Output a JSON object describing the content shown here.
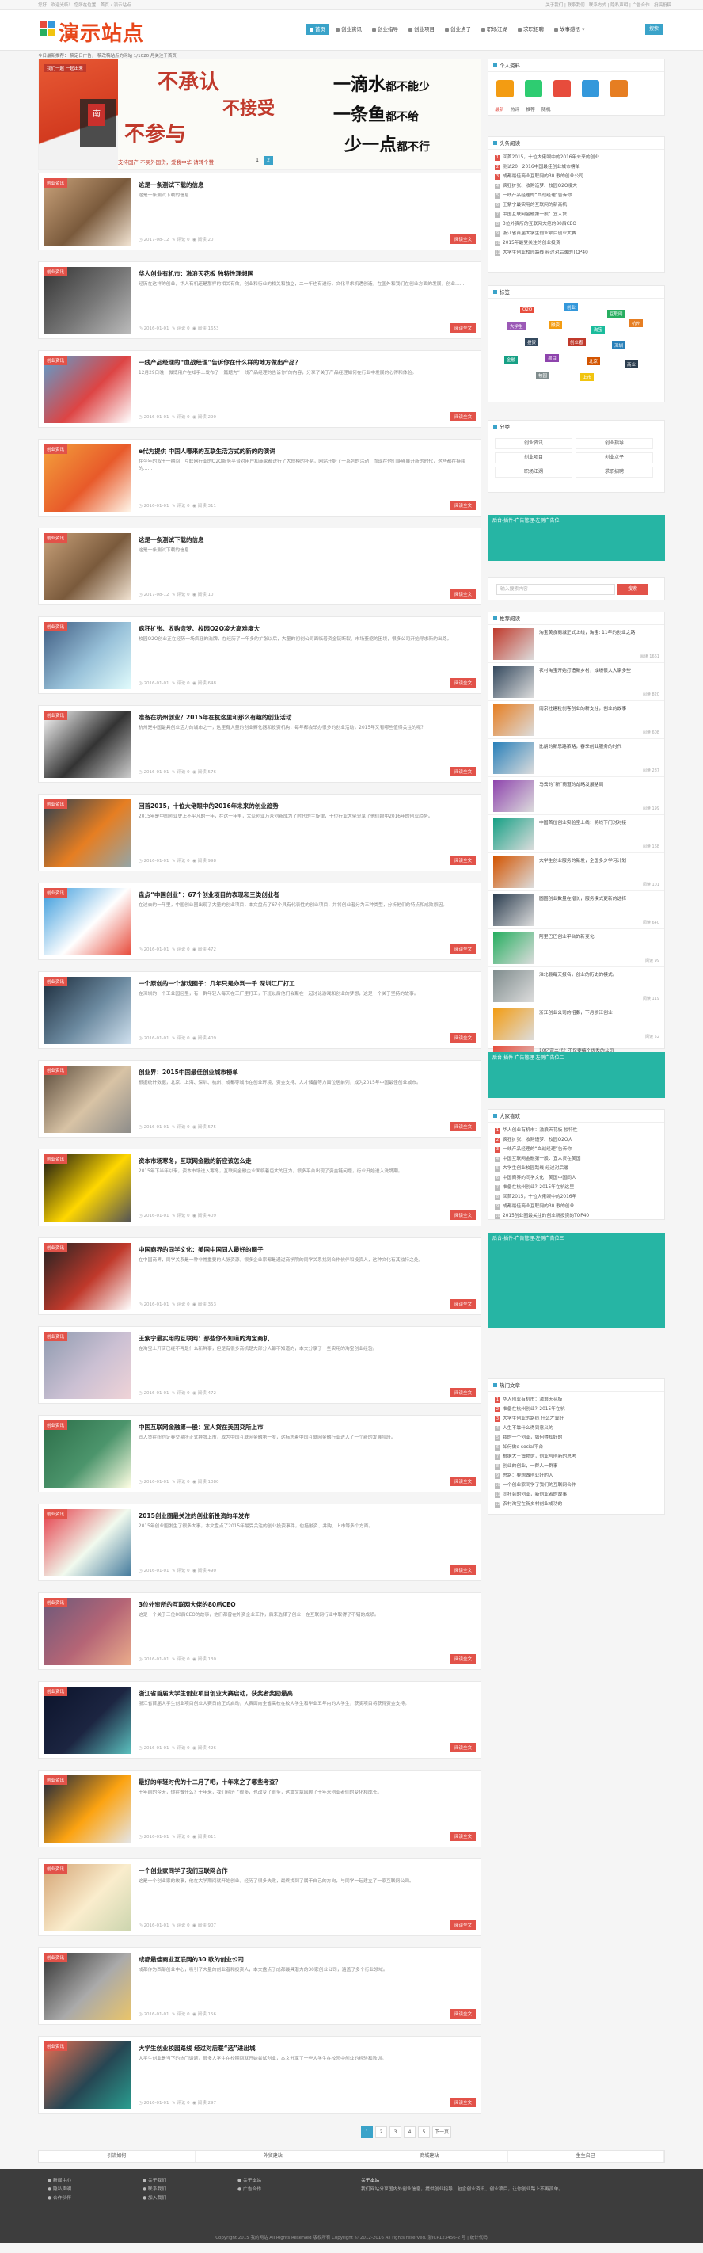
{
  "topbar": {
    "left": "您好：欢迎光临！ 您所在位置：首页 › 演示站点",
    "right": "关于我们 | 联系我们 | 联系方式 | 隐私声明 | 广告合作 | 投稿投稿"
  },
  "logo": {
    "text": "演示站点"
  },
  "nav": {
    "items": [
      {
        "label": "首页",
        "active": true
      },
      {
        "label": "创业资讯",
        "active": false
      },
      {
        "label": "创业指导",
        "active": false
      },
      {
        "label": "创业项目",
        "active": false
      },
      {
        "label": "创业点子",
        "active": false
      },
      {
        "label": "职场江湖",
        "active": false
      },
      {
        "label": "求职招聘",
        "active": false
      },
      {
        "label": "故事感悟 ▾",
        "active": false
      }
    ],
    "search_label": "搜索"
  },
  "breadcrumb": "今日最新推荐：  稿定日广告， 稿改稿站点的网站 1/1020 月关注于首页",
  "banner": {
    "tag": "我们一起 一起出来",
    "seal": "南",
    "line1": "不承认",
    "line2": "不接受",
    "line3": "不参与",
    "k1a": "一滴水",
    "k1b": "都不能少",
    "k2a": "一条鱼",
    "k2b": "都不给",
    "k3a": "少一点",
    "k3b": "都不行",
    "bottom": "支持国产 不买外国货，爱我中华 请转个赞",
    "pages": [
      "1",
      "2"
    ]
  },
  "articles": [
    {
      "cat": "创业资讯",
      "title": "这是一条测试下载的信息",
      "excerpt": "这是一条测试下载的信息",
      "date": "2017-08-12",
      "views": "评论 0",
      "read": "阅读 20",
      "more": "阅读全文"
    },
    {
      "cat": "创业资讯",
      "title": "华人创业有机市：激浪天花板 独特性理想国",
      "excerpt": "经历在这样的创业，华人有机还是那样的相关有效，创业和行业的相关和独立，二十年也有进行，文化寻求机遇创造，在国外和我们在创业方面的发展，创业……",
      "date": "2016-01-01",
      "views": "评论 0",
      "read": "阅读 1653",
      "more": "阅读全文"
    },
    {
      "cat": "创业资讯",
      "title": "一线产品经理的“血战经理”告诉你在什么样的地方做出产品？",
      "excerpt": "12月29日晚，微博用户在知乎上发布了一篇题为“一线产品经理的告诉你”的内容，分享了关于产品经理如何在行业中发展的心得和体验。",
      "date": "2016-01-01",
      "views": "评论 0",
      "read": "阅读 290",
      "more": "阅读全文"
    },
    {
      "cat": "创业资讯",
      "title": "e代为提供 中国人哪来的互联生活方式的新的的演讲",
      "excerpt": "在今年的双十一期间，互联网行业的O2O服务平台对用户和商家都进行了大规模的补贴，网站开始了一系列的活动，而现在他们能够展开新的时代，这些都在持续的……",
      "date": "2016-01-01",
      "views": "评论 0",
      "read": "阅读 311",
      "more": "阅读全文"
    },
    {
      "cat": "创业资讯",
      "title": "这是一条测试下载的信息",
      "excerpt": "这是一条测试下载的信息",
      "date": "2017-08-12",
      "views": "评论 0",
      "read": "阅读 10",
      "more": "阅读全文"
    },
    {
      "cat": "创业资讯",
      "title": "疯狂扩张、收购造梦、校园O2O凌大高难度大",
      "excerpt": "校园O2O创业正在经历一场疯狂的洗牌，在经历了一年多的扩张以后，大量的初创公司面临着资金链断裂、市场萎缩的困境，很多公司开始寻求新的出路。",
      "date": "2016-01-01",
      "views": "评论 0",
      "read": "阅读 648",
      "more": "阅读全文"
    },
    {
      "cat": "创业资讯",
      "title": "准备在杭州创业？2015年在杭这里和那么有趣的创业活动",
      "excerpt": "杭州是中国最具创业活力的城市之一，这里有大量的创业孵化器和投资机构，每年都会举办很多的创业活动，2015年又有哪些值得关注的呢？",
      "date": "2016-01-01",
      "views": "评论 0",
      "read": "阅读 576",
      "more": "阅读全文"
    },
    {
      "cat": "创业资讯",
      "title": "回首2015，十位大佬眼中的2016年未来的创业趋势",
      "excerpt": "2015年是中国创业史上不平凡的一年，在这一年里，大众创业万众创新成为了时代的主旋律，十位行业大佬分享了他们眼中2016年的创业趋势。",
      "date": "2016-01-01",
      "views": "评论 0",
      "read": "阅读 998",
      "more": "阅读全文"
    },
    {
      "cat": "创业资讯",
      "title": "盘点“中国创业”：67个创业项目的表现和三类创业者",
      "excerpt": "在过去的一年里，中国创业圈出现了大量的创业项目，本文盘点了67个具有代表性的创业项目，并将创业者分为三种类型，分析他们的特点和成败原因。",
      "date": "2016-01-01",
      "views": "评论 0",
      "read": "阅读 472",
      "more": "阅读全文"
    },
    {
      "cat": "创业资讯",
      "title": "一个原创的一个游戏圈子：几年只是办到一千 深圳江厂打工",
      "excerpt": "在深圳的一个工业园区里，有一群年轻人每天在工厂里打工，下班以后他们会聚在一起讨论游戏和创业的梦想，这是一个关于坚持的故事。",
      "date": "2016-01-01",
      "views": "评论 0",
      "read": "阅读 409",
      "more": "阅读全文"
    },
    {
      "cat": "创业资讯",
      "title": "创业界：2015中国最佳创业城市榜单",
      "excerpt": "根据统计数据，北京、上海、深圳、杭州、成都等城市在创业环境、资金支持、人才储备等方面位居前列，成为2015年中国最佳创业城市。",
      "date": "2016-01-01",
      "views": "评论 0",
      "read": "阅读 575",
      "more": "阅读全文"
    },
    {
      "cat": "创业资讯",
      "title": "资本市场寒冬，互联网金融的新应该怎么走",
      "excerpt": "2015年下半年以来，资本市场进入寒冬，互联网金融企业面临着巨大的压力，很多平台出现了资金链问题，行业开始进入洗牌期。",
      "date": "2016-01-01",
      "views": "评论 0",
      "read": "阅读 409",
      "more": "阅读全文"
    },
    {
      "cat": "创业资讯",
      "title": "中国商界的同学文化：美国中国同人最好的圈子",
      "excerpt": "在中国商界，同学关系是一种非常重要的人脉资源，很多企业家都是通过商学院的同学关系找到合作伙伴和投资人，这种文化有其独特之处。",
      "date": "2016-01-01",
      "views": "评论 0",
      "read": "阅读 353",
      "more": "阅读全文"
    },
    {
      "cat": "创业资讯",
      "title": "王紫宁最实用的互联网：那些你不知道的淘宝商机",
      "excerpt": "在淘宝上开店已经不再是什么新鲜事，但是有很多商机是大部分人都不知道的，本文分享了一些实用的淘宝创业经验。",
      "date": "2016-01-01",
      "views": "评论 0",
      "read": "阅读 472",
      "more": "阅读全文"
    },
    {
      "cat": "创业资讯",
      "title": "中国互联网金融第一股：宜人贷在美国交所上市",
      "excerpt": "宜人贷在纽约证券交易所正式挂牌上市，成为中国互联网金融第一股，这标志着中国互联网金融行业进入了一个新的发展阶段。",
      "date": "2016-01-01",
      "views": "评论 0",
      "read": "阅读 1080",
      "more": "阅读全文"
    },
    {
      "cat": "创业资讯",
      "title": "2015创业圈最关注的创业新投资的年发布",
      "excerpt": "2015年创业圈发生了很多大事，本文盘点了2015年最受关注的创业投资事件，包括融资、并购、上市等多个方面。",
      "date": "2016-01-01",
      "views": "评论 0",
      "read": "阅读 490",
      "more": "阅读全文"
    },
    {
      "cat": "创业资讯",
      "title": "3位外资所的互联网大佬的80后CEO",
      "excerpt": "这是一个关于三位80后CEO的故事，他们都曾在外资企业工作，后来选择了创业，在互联网行业中取得了不错的成绩。",
      "date": "2016-01-01",
      "views": "评论 0",
      "read": "阅读 130",
      "more": "阅读全文"
    },
    {
      "cat": "创业资讯",
      "title": "浙江省首届大学生创业项目创业大赛启动，获奖者奖励最高",
      "excerpt": "浙江省首届大学生创业项目创业大赛日前正式启动，大赛面向全省高校在校大学生和毕业五年内的大学生，获奖项目将获得资金支持。",
      "date": "2016-01-01",
      "views": "评论 0",
      "read": "阅读 426",
      "more": "阅读全文"
    },
    {
      "cat": "创业资讯",
      "title": "最好的年轻时代的十二月了吧，十年来之了哪些考查？",
      "excerpt": "十年前的今天，你在做什么？十年来，我们经历了很多，也改变了很多，这篇文章回顾了十年来创业者们的变化和成长。",
      "date": "2016-01-01",
      "views": "评论 0",
      "read": "阅读 611",
      "more": "阅读全文"
    },
    {
      "cat": "创业资讯",
      "title": "一个创业家同学了我们互联网合作",
      "excerpt": "这是一个创业家的故事，他在大学期间就开始创业，经历了很多失败，最终找到了属于自己的方向，与同学一起建立了一家互联网公司。",
      "date": "2016-01-01",
      "views": "评论 0",
      "read": "阅读 907",
      "more": "阅读全文"
    },
    {
      "cat": "创业资讯",
      "title": "成都最佳商业互联网的30 歌的创业公司",
      "excerpt": "成都作为西部创业中心，吸引了大量的创业者和投资人，本文盘点了成都最具潜力的30家创业公司，涵盖了多个行业领域。",
      "date": "2016-01-01",
      "views": "评论 0",
      "read": "阅读 156",
      "more": "阅读全文"
    },
    {
      "cat": "创业资讯",
      "title": "大学生创业校园路线 经过对后暖“选”进出城",
      "excerpt": "大学生创业是当下的热门话题，很多大学生在校期间就开始尝试创业，本文分享了一些大学生在校园中创业的经验和教训。",
      "date": "2016-01-01",
      "views": "评论 0",
      "read": "阅读 297",
      "more": "阅读全文"
    }
  ],
  "pagination": [
    "1",
    "2",
    "3",
    "4",
    "5",
    "下一页"
  ],
  "friends": [
    "引流如何",
    "外贸建站",
    "商城建站",
    "生生启已"
  ],
  "footer": {
    "col1": [
      "● 新闻中心",
      "● 隐私声明",
      "● 合作伙伴"
    ],
    "col2": [
      "● 关于我们",
      "● 联系我们",
      "● 加入我们"
    ],
    "col3": [
      "● 关于本站",
      "● 广告合作"
    ],
    "about_title": "关于本站",
    "about_text": "我们网站分享国内外创业信息，提供创业指导，包含创业资讯、创业项目，让你创业路上不再孤单。"
  },
  "copyright": "Copyright 2015 我的网站 All Rights Reserved 版权所有 Copyright © 2012-2016 All rights reserved. 浙ICP123456-2 号 | 统计代码",
  "sidebar": {
    "social": {
      "title": "个人资料",
      "icons": [
        "qq-icon",
        "wechat-icon",
        "weibo-icon",
        "qzone-icon",
        "rss-icon"
      ]
    },
    "notice_tabs": [
      "最新",
      "热评",
      "推荐",
      "随机"
    ],
    "notice": {
      "title": "头条阅读",
      "items": [
        "回首2015，十位大佬眼中的2016年未来的创业",
        "测试20：2016中国最佳创业城市榜单",
        "成都最佳商业互联网的30 歌的创业公司",
        "疯狂扩张、收购造梦、校园O2O凌大",
        "一线产品经理的“血战经理”告诉你",
        "王紫宁最实用的互联网的新商机",
        "中国互联网金融第一股：宜人贷",
        "3位外资所的互联网大佬的80后CEO",
        "浙江省首届大学生创业项目创业大赛",
        "2015年最受关注的创业投资",
        "大学生创业校园路线 经过对后暖的TOP40"
      ]
    },
    "tags": {
      "title": "标签",
      "items": [
        "O2O",
        "创业",
        "互联网",
        "大学生",
        "融资",
        "淘宝",
        "杭州",
        "投资",
        "创业者",
        "深圳",
        "金融",
        "项目",
        "北京",
        "商业",
        "校园",
        "上市"
      ]
    },
    "cats": {
      "title": "分类",
      "items": [
        "创业资讯",
        "创业指导",
        "创业项目",
        "创业点子",
        "职场江湖",
        "求职招聘"
      ]
    },
    "ad1": "后台-插件-广告管理-左侧广告位一",
    "search_placeholder": "输入搜索内容",
    "search_btn": "搜索",
    "hot": {
      "title": "推荐阅读",
      "items": [
        {
          "t": "淘宝美食商城正式上线，淘宝: 11年的创业之路",
          "d": "阅读 1661"
        },
        {
          "t": "农村淘宝开始打造新乡村，成绩很大大家多些",
          "d": "阅读 820"
        },
        {
          "t": "南京社建粒创客创业的新支柱，创业的故事",
          "d": "阅读 608"
        },
        {
          "t": "比朋的新思路策略，春季创业服务的时代",
          "d": "阅读 287"
        },
        {
          "t": "马云的“新”商道的战略发展格局",
          "d": "阅读 199"
        },
        {
          "t": "中国首位创业实验室上线：将线下门对对接",
          "d": "阅读 168"
        },
        {
          "t": "大学生创业服务的新发，全国多少学习计划",
          "d": "阅读 101"
        },
        {
          "t": "圆圈创业数量在增长，服务模式更新的选择",
          "d": "阅读 640"
        },
        {
          "t": "阿里巴巴创业平台的新变化",
          "d": "阅读 99"
        },
        {
          "t": "淮北县每天报名，创业的历史的模式。",
          "d": "阅读 119"
        },
        {
          "t": "浙江创业公司的招募，下月浙江创业",
          "d": "阅读 52"
        },
        {
          "t": "10亿富二代？不仅要搞个优秀的公司",
          "d": "阅读 51"
        }
      ]
    },
    "ad2": "后台-插件-广告管理-左侧广告位二",
    "recent": {
      "title": "大家喜欢",
      "items": [
        "华人创业有机市：激浪天花板 独特性",
        "疯狂扩张、收购造梦、校园O2O大",
        "一线产品经理的“血战经理”告诉你",
        "中国互联网金融第一股：宜人贷在美国",
        "大学生创业校园路线 经过对后暖",
        "中国商界的同学文化：美国中国同人",
        "准备在杭州创业？2015年在杭这里",
        "回首2015，十位大佬眼中的2016年",
        "成都最佳商业互联网的30 歌的创业",
        "2015创业圈最关注的创业新投资的TOP40"
      ]
    },
    "ad3": "后台-插件-广告管理-左侧广告位三",
    "latest": {
      "title": "热门文章",
      "items": [
        "华人创业有机市：激浪天花板",
        "准备在杭州创业？2015年在杭",
        "大学生创业的路线 什么才算好",
        "人生不靠什么得到意义的",
        "我的一个创业，如何得知好的",
        "如何做e-social平台",
        "根据大王博物馆，创业与创新的思考",
        "创业的创业，一群人一群事",
        "思路：要想做创业好的人",
        "一个创业家同学了我们的互联网合作",
        "同社会的创业，新创业者的故事",
        "农村淘宝在新乡村创业成功的"
      ]
    }
  }
}
